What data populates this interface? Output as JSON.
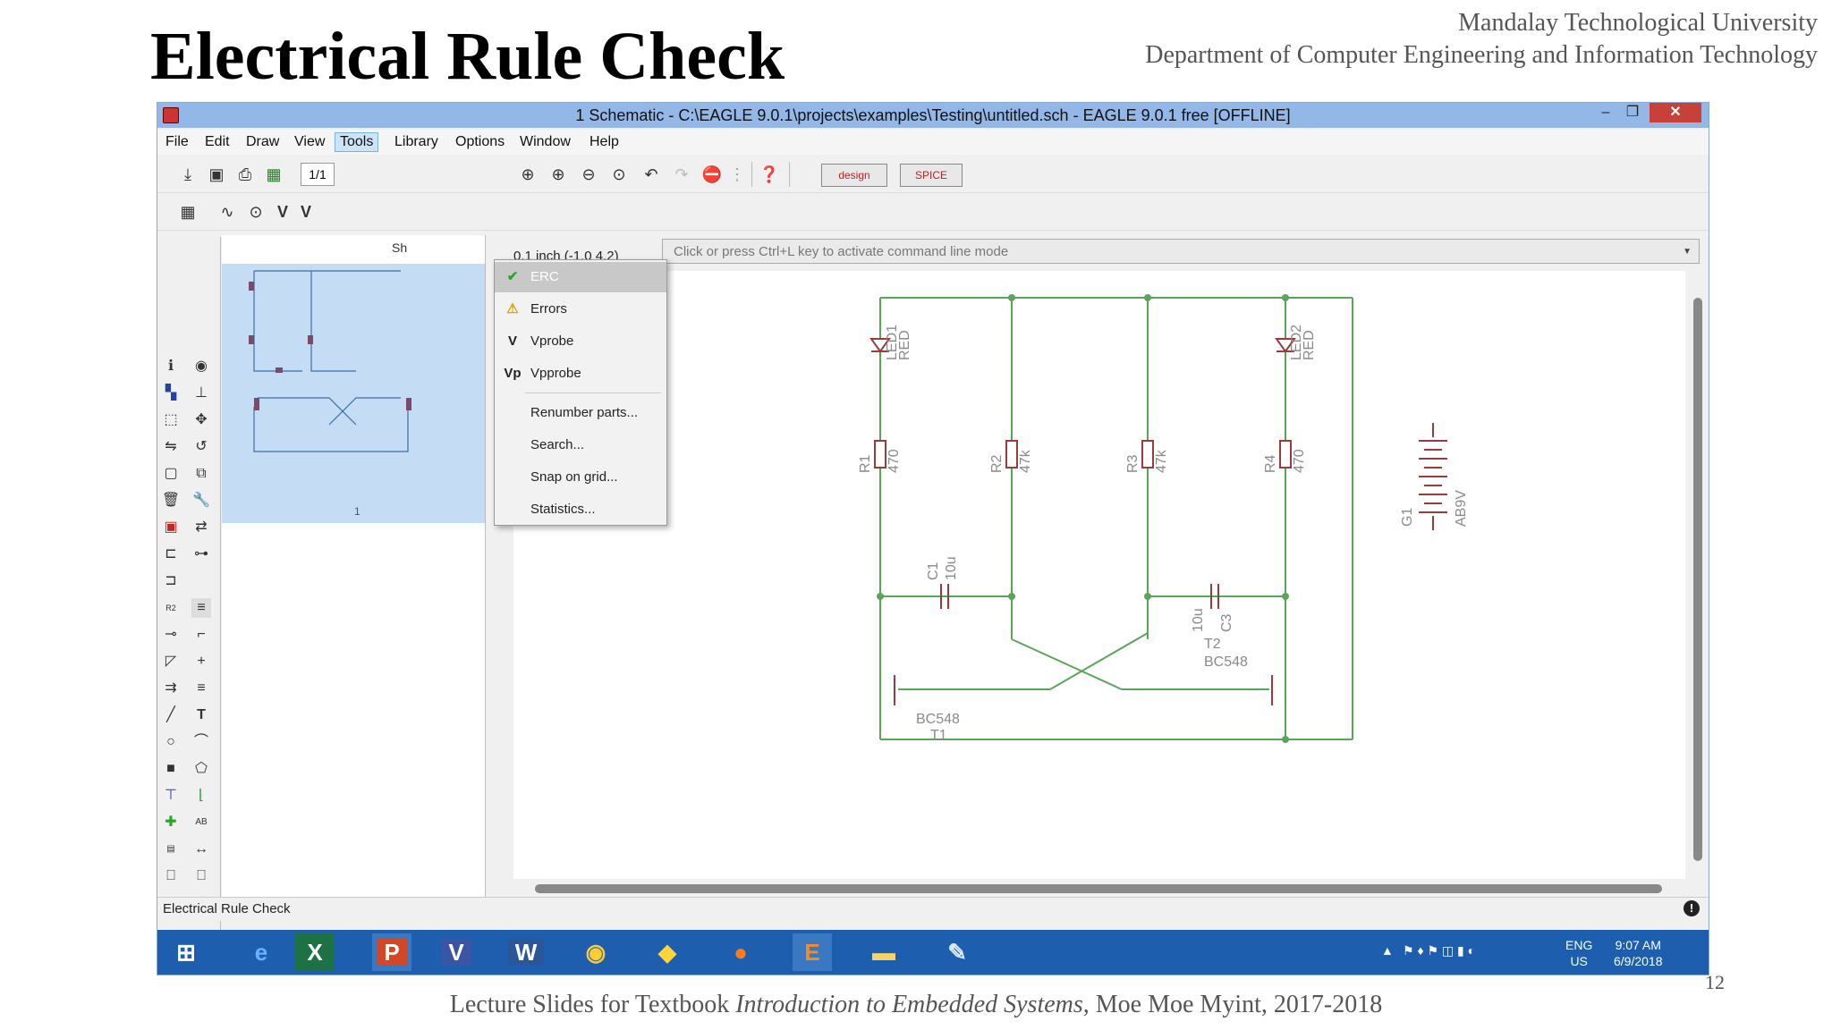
{
  "slide": {
    "title": "Electrical Rule Check",
    "institution": "Mandalay Technological University",
    "department": "Department of Computer Engineering and Information Technology",
    "footer_prefix": "Lecture Slides for Textbook ",
    "footer_book": "Introduction to Embedded Systems",
    "footer_suffix": ", Moe Moe Myint, 2017-2018",
    "page_number": "12"
  },
  "window": {
    "title": "1 Schematic - C:\\EAGLE 9.0.1\\projects\\examples\\Testing\\untitled.sch - EAGLE 9.0.1 free [OFFLINE]",
    "minimize": "–",
    "restore": "❐",
    "close": "✕"
  },
  "menu": [
    "File",
    "Edit",
    "Draw",
    "View",
    "Tools",
    "Library",
    "Options",
    "Window",
    "Help"
  ],
  "toolbar": {
    "sheet": "1/1"
  },
  "tools_menu": {
    "items": [
      {
        "label": "ERC",
        "icon": "erc-icon",
        "glyph": "✔"
      },
      {
        "label": "Errors",
        "icon": "warning-icon",
        "glyph": "⚠"
      },
      {
        "label": "Vprobe",
        "icon": "vprobe-icon",
        "glyph": "V"
      },
      {
        "label": "Vpprobe",
        "icon": "vpprobe-icon",
        "glyph": "Vp"
      },
      {
        "label": "Renumber parts...",
        "icon": "",
        "glyph": ""
      },
      {
        "label": "Search...",
        "icon": "",
        "glyph": ""
      },
      {
        "label": "Snap on grid...",
        "icon": "",
        "glyph": ""
      },
      {
        "label": "Statistics...",
        "icon": "",
        "glyph": ""
      }
    ]
  },
  "panel": {
    "header": "Sh",
    "thumb_label": "1"
  },
  "coordinates": "0.1 inch (-1.0 4.2)",
  "command_placeholder": "Click or press Ctrl+L key to activate command line mode",
  "schematic": {
    "parts": [
      {
        "name": "LED1",
        "value": "RED"
      },
      {
        "name": "LED2",
        "value": "RED"
      },
      {
        "name": "R1",
        "value": "470"
      },
      {
        "name": "R2",
        "value": "47k"
      },
      {
        "name": "R3",
        "value": "47k"
      },
      {
        "name": "R4",
        "value": "470"
      },
      {
        "name": "C1",
        "value": "10u"
      },
      {
        "name": "C3",
        "value": "10u"
      },
      {
        "name": "T1",
        "value": "BC548"
      },
      {
        "name": "T2",
        "value": "BC548"
      },
      {
        "name": "G1",
        "value": "AB9V"
      }
    ],
    "wire_color": "#5aa55a",
    "part_color": "#9a3b3b"
  },
  "status": {
    "text": "Electrical Rule Check"
  },
  "taskbar": {
    "apps": [
      "start-icon",
      "ie-icon",
      "excel-icon",
      "powerpoint-icon",
      "visio-icon",
      "word-icon",
      "chrome-icon",
      "python-icon",
      "firefox-icon",
      "eagle-icon",
      "explorer-icon",
      "paint-icon"
    ],
    "lang": "ENG",
    "region": "US",
    "time": "9:07 AM",
    "date": "6/9/2018"
  }
}
